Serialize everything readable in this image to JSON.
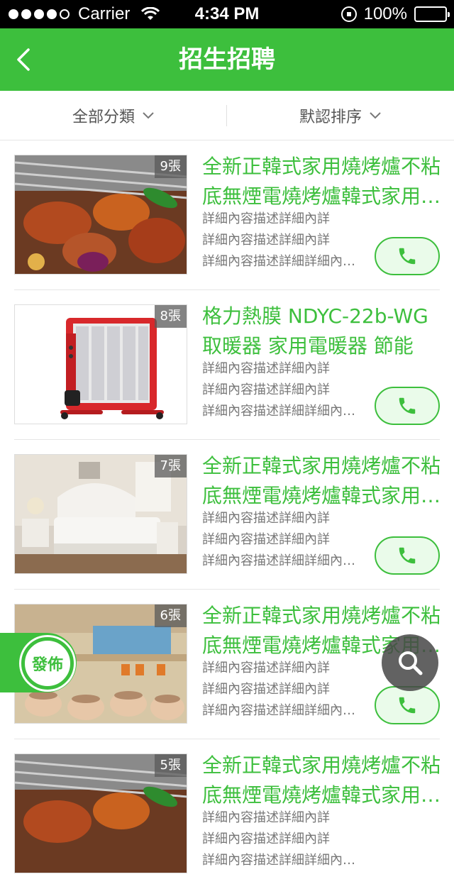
{
  "status_bar": {
    "carrier": "Carrier",
    "time": "4:34 PM",
    "battery": "100%"
  },
  "nav": {
    "title": "招生招聘"
  },
  "filters": [
    {
      "label": "全部分類"
    },
    {
      "label": "默認排序"
    }
  ],
  "items": [
    {
      "image": "bbq-grill",
      "photo_count": "9張",
      "title": "全新正韓式家用燒烤爐不粘底無煙電燒烤爐韓式家用燒烤爐",
      "desc": [
        "詳細內容描述詳細內詳",
        "詳細內容描述詳細內詳",
        "詳細內容描述詳細詳細內容描述"
      ]
    },
    {
      "image": "red-heater",
      "photo_count": "8張",
      "title": "格力熱膜 NDYC-22b-WG 取暖器 家用電暖器 節能",
      "desc": [
        "詳細內容描述詳細內詳",
        "詳細內容描述詳細內詳",
        "詳細內容描述詳細詳細內容描述"
      ]
    },
    {
      "image": "bedroom",
      "photo_count": "7張",
      "title": "全新正韓式家用燒烤爐不粘底無煙電燒烤爐韓式家用燒烤爐",
      "desc": [
        "詳細內容描述詳細內詳",
        "詳細內容描述詳細內詳",
        "詳細內容描述詳細詳細內容描述"
      ]
    },
    {
      "image": "appliance-store",
      "photo_count": "6張",
      "title": "全新正韓式家用燒烤爐不粘底無煙電燒烤爐韓式家用燒烤爐",
      "desc": [
        "詳細內容描述詳細內詳",
        "詳細內容描述詳細內詳",
        "詳細內容描述詳細詳細內容描述"
      ]
    },
    {
      "image": "bbq-grill",
      "photo_count": "5張",
      "title": "全新正韓式家用燒烤爐不粘底無煙電燒烤爐韓式家用燒烤爐",
      "desc": [
        "詳細內容描述詳細內詳",
        "詳細內容描述詳細內詳",
        "詳細內容描述詳細詳細內容描述"
      ]
    }
  ],
  "publish_label": "發佈",
  "colors": {
    "accent": "#3dbf3d",
    "text_secondary": "#777777",
    "fab_dark": "#464646"
  }
}
